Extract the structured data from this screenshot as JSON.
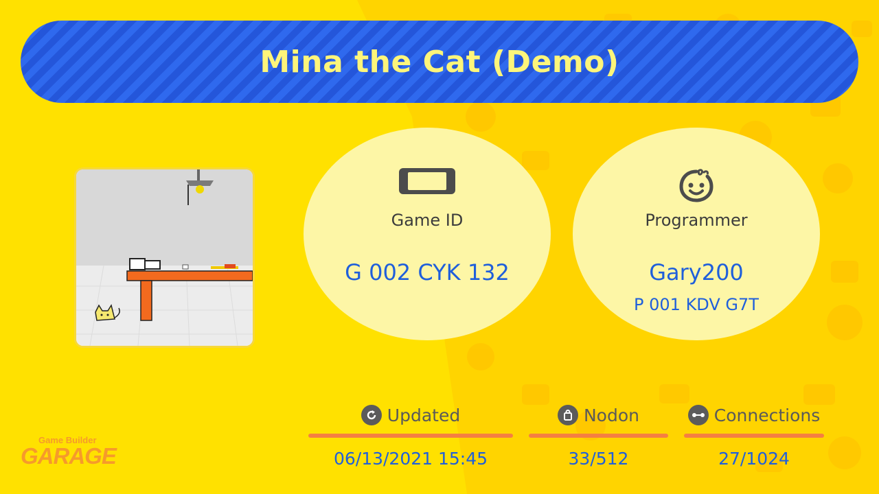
{
  "game": {
    "title": "Mina the Cat (Demo)",
    "game_id_label": "Game ID",
    "game_id": "G 002 CYK 132",
    "programmer_label": "Programmer",
    "programmer_name": "Gary200",
    "programmer_id": "P 001 KDV G7T"
  },
  "stats": {
    "updated_label": "Updated",
    "updated_value": "06/13/2021 15:45",
    "nodon_label": "Nodon",
    "nodon_value": "33/512",
    "connections_label": "Connections",
    "connections_value": "27/1024"
  },
  "logo": {
    "small_text": "Game Builder",
    "big_text": "GARAGE"
  },
  "icons": {
    "game_id": "handheld-console-icon",
    "programmer": "smiling-face-icon",
    "updated": "refresh-icon",
    "nodon": "bag-icon",
    "connections": "connection-icon"
  },
  "colors": {
    "banner": "#2f69ee",
    "title": "#fdf57a",
    "value_text": "#1f5fdb",
    "background": "#ffe100",
    "accent_bar": "#f57f42"
  }
}
